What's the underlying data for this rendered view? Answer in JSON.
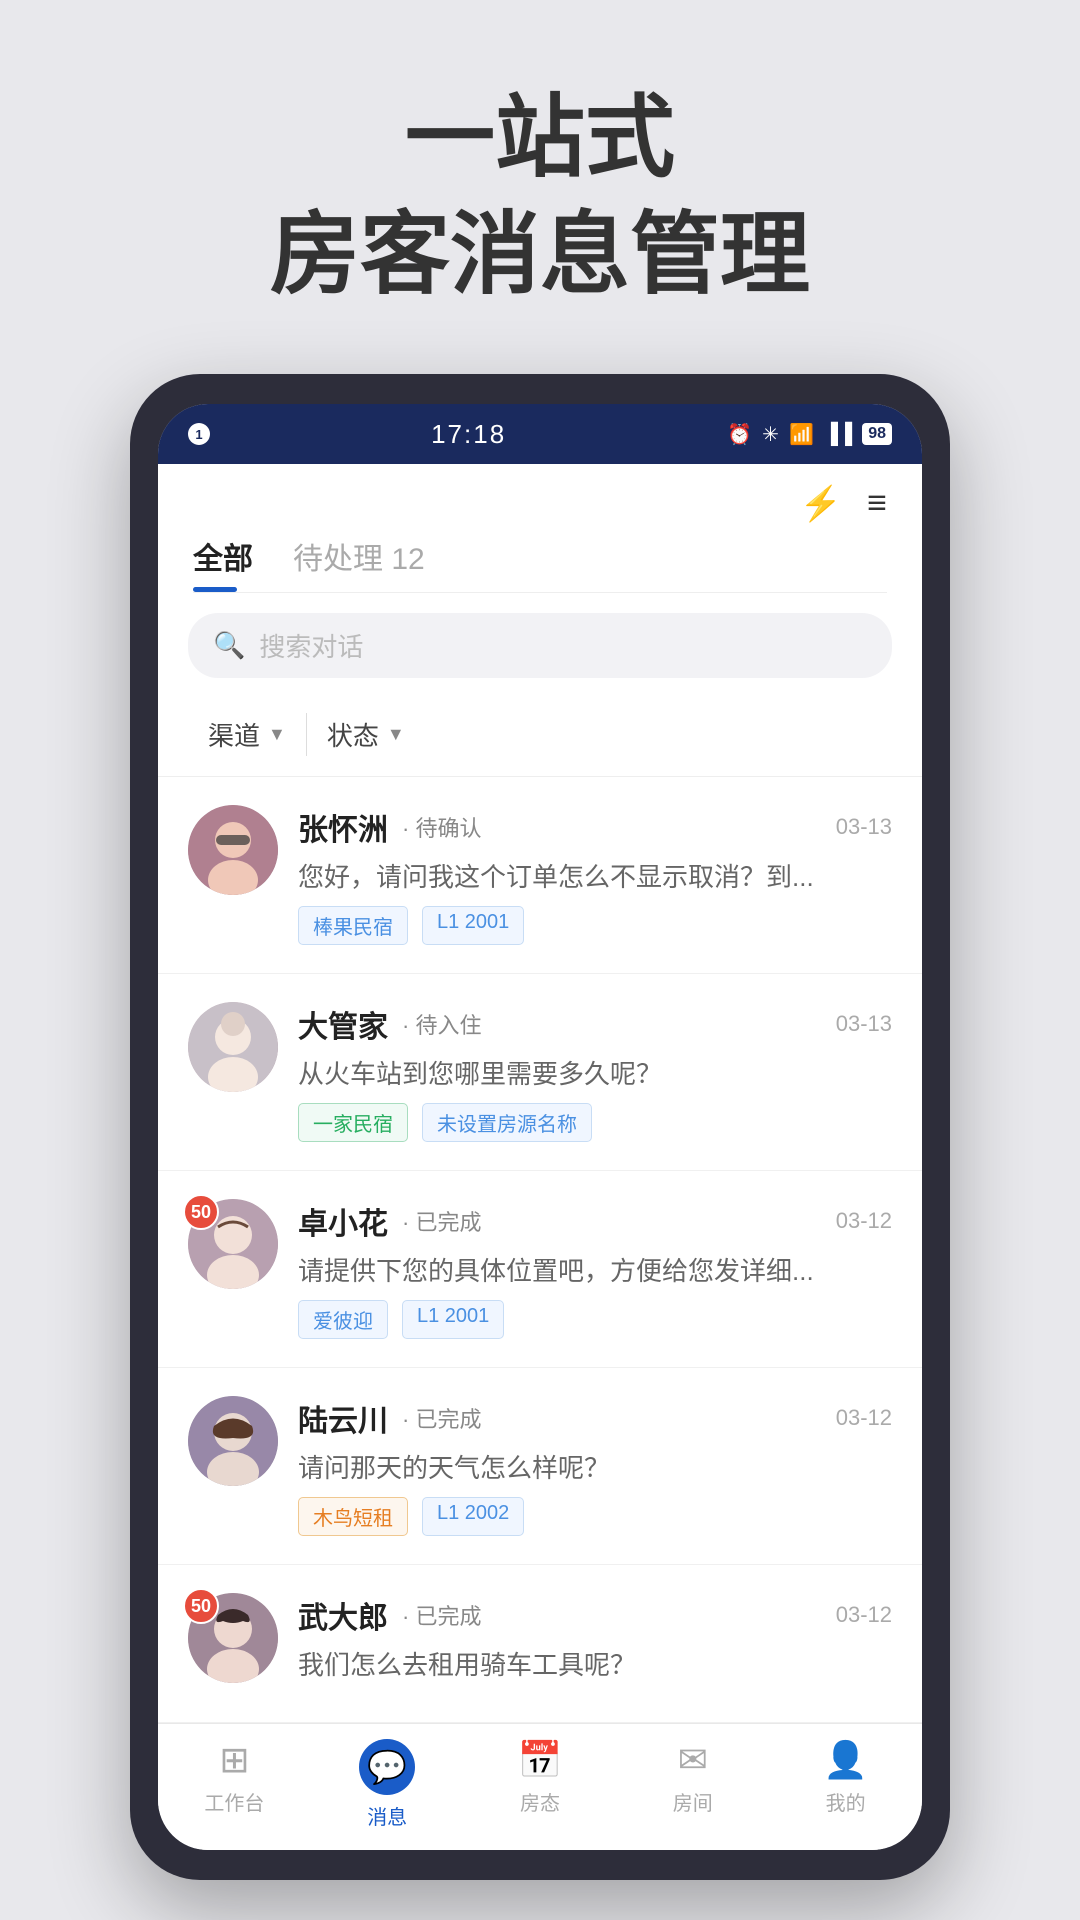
{
  "hero": {
    "line1": "一站式",
    "line2": "房客消息管理"
  },
  "statusBar": {
    "dot": "1",
    "time": "17:18",
    "icons": [
      "⏰",
      "✳",
      "WiFi",
      "▐▐▐",
      "98"
    ],
    "battery": "98"
  },
  "header": {
    "flashIcon": "⚡",
    "menuIcon": "≡"
  },
  "tabs": [
    {
      "label": "全部",
      "active": true
    },
    {
      "label": "待处理 12",
      "active": false
    }
  ],
  "search": {
    "placeholder": "搜索对话"
  },
  "filters": [
    {
      "label": "渠道",
      "arrow": "▼"
    },
    {
      "label": "状态",
      "arrow": "▼"
    }
  ],
  "messages": [
    {
      "name": "张怀洲",
      "status": "· 待确认",
      "date": "03-13",
      "preview": "您好，请问我这个订单怎么不显示取消？到...",
      "tags": [
        "棒果民宿",
        "L1 2001"
      ],
      "tagTypes": [
        "blue",
        "gray"
      ],
      "badge": null,
      "avatarType": "female1",
      "avatarEmoji": "👩"
    },
    {
      "name": "大管家",
      "status": "· 待入住",
      "date": "03-13",
      "preview": "从火车站到您哪里需要多久呢？",
      "tags": [
        "一家民宿",
        "未设置房源名称"
      ],
      "tagTypes": [
        "green",
        "gray"
      ],
      "badge": null,
      "avatarType": "female2",
      "avatarEmoji": "🌸"
    },
    {
      "name": "卓小花",
      "status": "· 已完成",
      "date": "03-12",
      "preview": "请提供下您的具体位置吧，方便给您发详细...",
      "tags": [
        "爱彼迎",
        "L1 2001"
      ],
      "tagTypes": [
        "blue",
        "gray"
      ],
      "badge": "50",
      "avatarType": "female3",
      "avatarEmoji": "💐"
    },
    {
      "name": "陆云川",
      "status": "· 已完成",
      "date": "03-12",
      "preview": "请问那天的天气怎么样呢？",
      "tags": [
        "木鸟短租",
        "L1 2002"
      ],
      "tagTypes": [
        "orange",
        "gray"
      ],
      "badge": null,
      "avatarType": "female4",
      "avatarEmoji": "👱"
    },
    {
      "name": "武大郎",
      "status": "· 已完成",
      "date": "03-12",
      "preview": "我们怎么去租用骑车工具呢？",
      "tags": [],
      "tagTypes": [],
      "badge": "50",
      "avatarType": "female5",
      "avatarEmoji": "💇"
    }
  ],
  "bottomNav": [
    {
      "label": "工作台",
      "icon": "⊞",
      "active": false
    },
    {
      "label": "消息",
      "icon": "💬",
      "active": true
    },
    {
      "label": "房态",
      "icon": "📅",
      "active": false
    },
    {
      "label": "房间",
      "icon": "✉",
      "active": false
    },
    {
      "label": "我的",
      "icon": "👤",
      "active": false
    }
  ]
}
